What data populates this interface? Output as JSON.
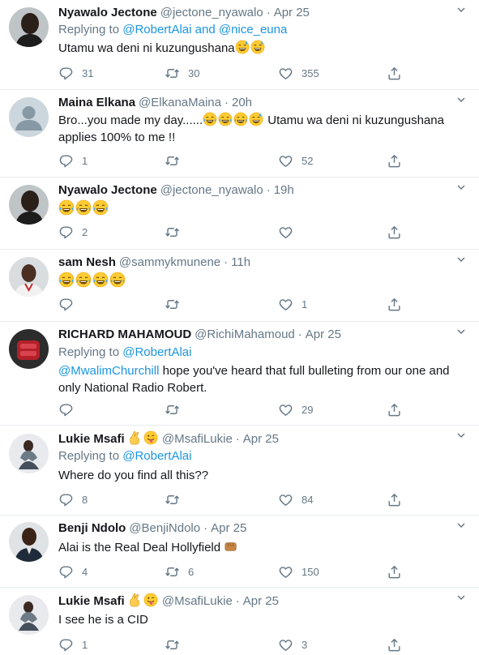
{
  "tweets": [
    {
      "name": "Nyawalo Jectone",
      "handle": "@jectone_nyawalo",
      "time": "Apr 25",
      "reply_prefix": "Replying to",
      "reply_mention_1": "@RobertAlai",
      "reply_joiner": "and",
      "reply_mention_2": "@nice_euna",
      "text": "Utamu wa deni ni kuzungushana",
      "emojis": [
        "grin-sweat",
        "grin-sweat"
      ],
      "replies": "31",
      "retweets": "30",
      "likes": "355"
    },
    {
      "name": "Maina Elkana",
      "handle": "@ElkanaMaina",
      "time": "20h",
      "text_before": "Bro...you made my day......",
      "emojis": [
        "joy",
        "joy",
        "joy",
        "grin-sweat"
      ],
      "text_after": " Utamu wa deni ni kuzungushana",
      "text_line2": "applies 100% to me !!",
      "replies": "1",
      "retweets": "",
      "likes": "52"
    },
    {
      "name": "Nyawalo Jectone",
      "handle": "@jectone_nyawalo",
      "time": "19h",
      "emojis": [
        "joy",
        "joy",
        "joy"
      ],
      "replies": "2",
      "retweets": "",
      "likes": ""
    },
    {
      "name": "sam Nesh",
      "handle": "@sammykmunene",
      "time": "11h",
      "emojis": [
        "joy",
        "joy",
        "joy",
        "joy"
      ],
      "replies": "",
      "retweets": "",
      "likes": "1"
    },
    {
      "name": "RICHARD MAHAMOUD",
      "handle": "@RichiMahamoud",
      "time": "Apr 25",
      "reply_prefix": "Replying to",
      "reply_mention_1": "@RobertAlai",
      "text_mention": "@MwalimChurchill",
      "text": " hope you've heard that full bulleting from our one and",
      "text_line2": "only National Radio Robert.",
      "replies": "",
      "retweets": "",
      "likes": "29"
    },
    {
      "name": "Lukie Msafi",
      "name_emojis": [
        "fingers-crossed",
        "winking-tongue"
      ],
      "handle": "@MsafiLukie",
      "time": "Apr 25",
      "reply_prefix": "Replying to",
      "reply_mention_1": "@RobertAlai",
      "text": "Where do you find all this??",
      "replies": "8",
      "retweets": "",
      "likes": "84"
    },
    {
      "name": "Benji Ndolo",
      "handle": "@BenjiNdolo",
      "time": "Apr 25",
      "text": "Alai is the Real Deal Hollyfield ",
      "emojis": [
        "fist"
      ],
      "replies": "4",
      "retweets": "6",
      "likes": "150"
    },
    {
      "name": "Lukie Msafi",
      "name_emojis": [
        "fingers-crossed",
        "winking-tongue"
      ],
      "handle": "@MsafiLukie",
      "time": "Apr 25",
      "text": "I see he is a CID",
      "replies": "1",
      "retweets": "",
      "likes": "3"
    }
  ],
  "ui": {
    "dot": "·",
    "colors": {
      "link": "#1b95e0",
      "secondary": "#657786",
      "divider": "#e6ecf0"
    },
    "icons": [
      "reply-icon",
      "retweet-icon",
      "like-icon",
      "share-icon",
      "caret-down-icon"
    ]
  }
}
